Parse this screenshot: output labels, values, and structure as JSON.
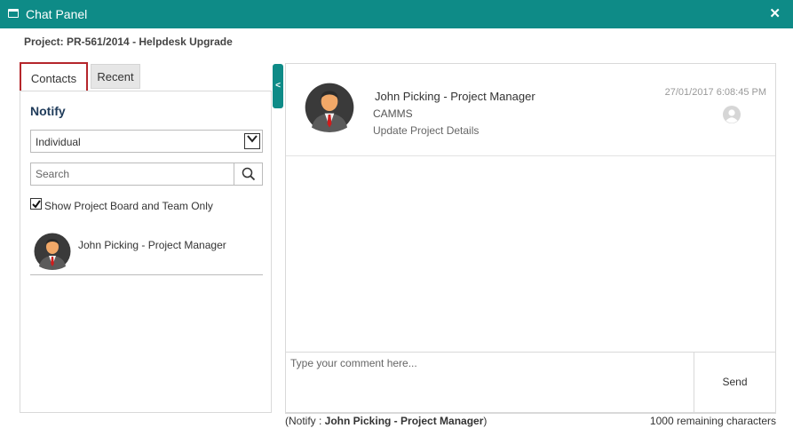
{
  "window": {
    "title": "Chat Panel",
    "close_symbol": "✕",
    "accent_color": "#0e8b87"
  },
  "project": {
    "title": "Project: PR-561/2014 - Helpdesk Upgrade"
  },
  "tabs": [
    {
      "label": "Contacts",
      "active": true
    },
    {
      "label": "Recent",
      "active": false
    }
  ],
  "notify": {
    "label": "Notify",
    "select_value": "Individual",
    "search_placeholder": "Search",
    "checkbox_label": "Show Project Board and Team Only",
    "checkbox_checked": true
  },
  "contacts": [
    {
      "name": "John Picking - Project Manager"
    }
  ],
  "collapse_symbol": "<",
  "messages": [
    {
      "sender": "John Picking - Project Manager",
      "org": "CAMMS",
      "action": "Update Project Details",
      "time": "27/01/2017 6:08:45 PM"
    }
  ],
  "comment": {
    "placeholder": "Type your comment here...",
    "send_label": "Send"
  },
  "footer": {
    "notify_prefix": "(Notify : ",
    "notify_name": "John Picking - Project Manager",
    "notify_suffix": ")",
    "remaining": "1000 remaining characters"
  }
}
